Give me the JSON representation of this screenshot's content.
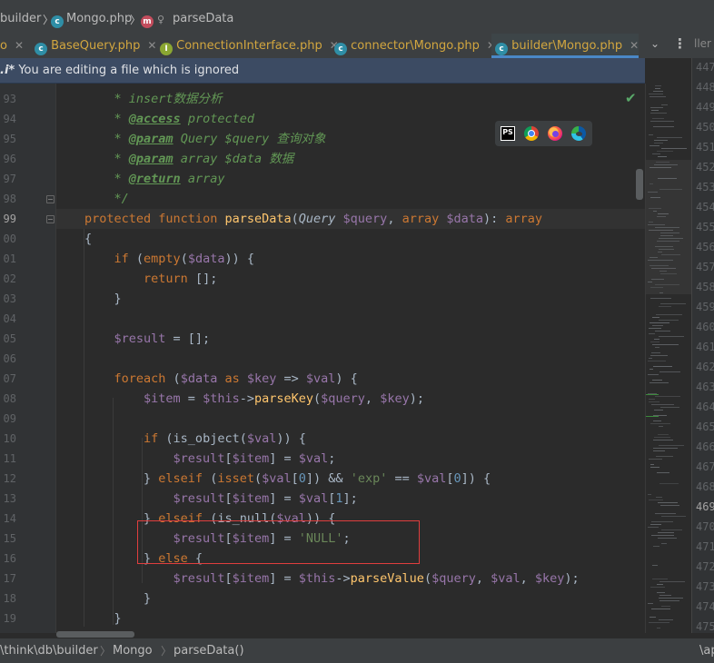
{
  "breadcrumb": {
    "folder": "builder",
    "file": "Mongo.php",
    "file_icon": "class-c-icon",
    "method_icon": "method-m-icon",
    "method": "parseData"
  },
  "tabs": [
    {
      "label": "BaseQuery.php",
      "icon": "class-c-icon"
    },
    {
      "label": "ConnectionInterface.php",
      "icon": "interface-i-icon"
    },
    {
      "label": "connector\\Mongo.php",
      "icon": "class-c-icon"
    },
    {
      "label": "builder\\Mongo.php",
      "icon": "class-c-icon",
      "active": true
    }
  ],
  "tab_left_fragment": "o",
  "tab_close": "✕",
  "tab_right_fragment": "ller",
  "notification": {
    "prefix": ".i*",
    "text": " You are editing a file which is ignored"
  },
  "gutter": {
    "lines": [
      "93",
      "94",
      "95",
      "96",
      "97",
      "98",
      "99",
      "00",
      "01",
      "02",
      "03",
      "04",
      "05",
      "06",
      "07",
      "08",
      "09",
      "10",
      "11",
      "12",
      "13",
      "14",
      "15",
      "16",
      "17",
      "18",
      "19"
    ],
    "current": "99"
  },
  "code_lines": [
    "    * insert数据分析",
    "    * @access protected",
    "    * @param Query $query 查询对象",
    "    * @param array $data 数据",
    "    * @return array",
    "    */",
    "protected function parseData(Query $query, array $data): array",
    "{",
    "    if (empty($data)) {",
    "        return [];",
    "    }",
    "",
    "    $result = [];",
    "",
    "    foreach ($data as $key => $val) {",
    "        $item = $this->parseKey($query, $key);",
    "",
    "        if (is_object($val)) {",
    "            $result[$item] = $val;",
    "        } elseif (isset($val[0]) && 'exp' == $val[0]) {",
    "            $result[$item] = $val[1];",
    "        } elseif (is_null($val)) {",
    "            $result[$item] = 'NULL';",
    "        } else {",
    "            $result[$item] = $this->parseValue($query, $val, $key);",
    "        }",
    "    }"
  ],
  "right_pane_lines": [
    "447",
    "448",
    "449",
    "450",
    "451",
    "452",
    "453",
    "454",
    "455",
    "456",
    "457",
    "458",
    "459",
    "460",
    "461",
    "462",
    "463",
    "464",
    "465",
    "466",
    "467",
    "468",
    "469",
    "470",
    "471",
    "472",
    "473",
    "474",
    "475"
  ],
  "right_pane_current": "469",
  "status": {
    "path": "\\think\\db\\builder",
    "class": "Mongo",
    "method": "parseData()",
    "right": "\\ap"
  },
  "browser_icons": [
    "phpstorm-icon",
    "chrome-icon",
    "firefox-icon",
    "edge-icon"
  ],
  "colors": {
    "keyword": "#cc7832",
    "function": "#ffc66d",
    "variable": "#9876aa",
    "string": "#6a8759",
    "doc": "#629755",
    "annotation_box": "#e03e3e"
  }
}
